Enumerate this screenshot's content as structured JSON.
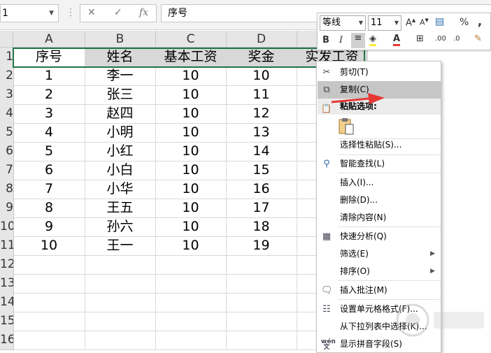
{
  "formula_bar": {
    "name_box": "1",
    "formula": "序号"
  },
  "columns": [
    "A",
    "B",
    "C",
    "D",
    ""
  ],
  "rows": [
    "1",
    "2",
    "3",
    "4",
    "5",
    "6",
    "7",
    "8",
    "9",
    "10",
    "11",
    "12",
    "13",
    "14",
    "15",
    "16"
  ],
  "table": {
    "headers": [
      "序号",
      "姓名",
      "基本工资",
      "奖金",
      "实发工资"
    ],
    "data": [
      [
        "1",
        "李一",
        "10",
        "10"
      ],
      [
        "2",
        "张三",
        "10",
        "11"
      ],
      [
        "3",
        "赵四",
        "10",
        "12"
      ],
      [
        "4",
        "小明",
        "10",
        "13"
      ],
      [
        "5",
        "小红",
        "10",
        "14"
      ],
      [
        "6",
        "小白",
        "10",
        "15"
      ],
      [
        "7",
        "小华",
        "10",
        "16"
      ],
      [
        "8",
        "王五",
        "10",
        "17"
      ],
      [
        "9",
        "孙六",
        "10",
        "18"
      ],
      [
        "10",
        "王一",
        "10",
        "19"
      ]
    ]
  },
  "mini_toolbar": {
    "font": "等线",
    "size": "11",
    "percent": "%",
    "comma": ","
  },
  "context_menu": {
    "cut": "剪切(T)",
    "copy": "复制(C)",
    "paste_options": "粘贴选项:",
    "paste_special": "选择性粘贴(S)...",
    "smart_lookup": "智能查找(L)",
    "insert": "插入(I)...",
    "delete": "删除(D)...",
    "clear": "清除内容(N)",
    "quick_analysis": "快速分析(Q)",
    "filter": "筛选(E)",
    "sort": "排序(O)",
    "insert_comment": "插入批注(M)",
    "format_cells": "设置单元格格式(F)...",
    "pick_list": "从下拉列表中选择(K)...",
    "phonetic": "显示拼音字段(S)"
  },
  "colors": {
    "selection": "#217346",
    "arrow": "#e53935",
    "highlight": "#c6c6c6"
  }
}
